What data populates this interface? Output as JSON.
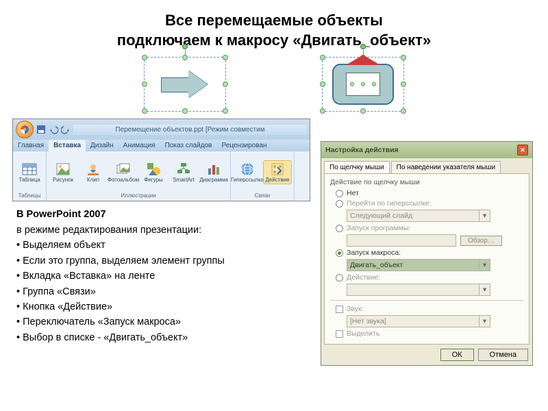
{
  "title_line1": "Все перемещаемые объекты",
  "title_line2": "подключаем к макросу «Двигать_объект»",
  "ribbon": {
    "window_title": "Перемещение объектов.ppt [Режим совместим",
    "tabs": [
      "Главная",
      "Вставка",
      "Дизайн",
      "Анимация",
      "Показ слайдов",
      "Рецензирован"
    ],
    "active_tab": "Вставка",
    "groups": {
      "tables": {
        "label": "Таблицы",
        "items": [
          "Таблица"
        ]
      },
      "illustrations": {
        "label": "Иллюстрации",
        "items": [
          "Рисунок",
          "Клип",
          "Фотоальбом",
          "Фигуры",
          "SmartArt",
          "Диаграмма"
        ]
      },
      "links": {
        "label": "Связи",
        "items": [
          "Гиперссылка",
          "Действие"
        ]
      }
    }
  },
  "instructions": {
    "heading": "В PowerPoint 2007",
    "intro": "в режиме редактирования презентации:",
    "bullets": [
      "Выделяем объект",
      "Если это группа, выделяем элемент группы",
      "Вкладка «Вставка» на ленте",
      "Группа «Связи»",
      "Кнопка «Действие»",
      "Переключатель «Запуск макроса»",
      "Выбор в списке - «Двигать_объект»"
    ]
  },
  "dialog": {
    "title": "Настройка действия",
    "tabs": [
      "По щелчку мыши",
      "По наведении указателя мыши"
    ],
    "group_label": "Действие по щелчку мыши",
    "opt_none": "Нет",
    "opt_link": "Перейти по гиперссылке:",
    "link_value": "Следующий слайд",
    "opt_prog": "Запуск программы:",
    "browse_btn": "Обзор…",
    "opt_macro": "Запуск макроса:",
    "macro_value": "Двигать_объект",
    "opt_ole": "Действие:",
    "chk_sound": "Звук:",
    "sound_value": "[Нет звука]",
    "chk_highlight": "Выделить",
    "ok": "ОК",
    "cancel": "Отмена"
  }
}
